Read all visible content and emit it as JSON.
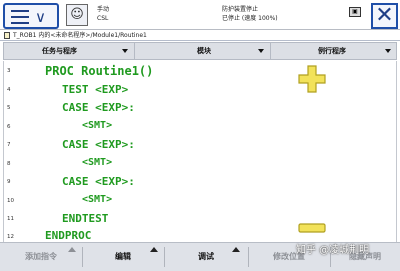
{
  "topbar": {
    "mode_label": "手动",
    "mode_sub": "CSL",
    "safety_label": "防护装置停止",
    "run_state": "已停止 (速度 100%)",
    "colors": {
      "accent": "#1f4fa8"
    }
  },
  "breadcrumb": {
    "text": "T_ROB1 内的<未命名程序>/Module1/Routine1"
  },
  "tabs": [
    {
      "label": "任务与程序"
    },
    {
      "label": "模块"
    },
    {
      "label": "例行程序"
    }
  ],
  "editor": {
    "code_color": "#1f9a1f",
    "lines": [
      {
        "num": "3",
        "text": "PROC Routine1()"
      },
      {
        "num": "4",
        "text": "TEST <EXP>"
      },
      {
        "num": "5",
        "text": "CASE <EXP>:"
      },
      {
        "num": "6",
        "text": "<SMT>"
      },
      {
        "num": "7",
        "text": "CASE <EXP>:"
      },
      {
        "num": "8",
        "text": "<SMT>"
      },
      {
        "num": "9",
        "text": "CASE <EXP>:"
      },
      {
        "num": "10",
        "text": "<SMT>"
      },
      {
        "num": "11",
        "text": "ENDTEST"
      },
      {
        "num": "12",
        "text": "ENDPROC"
      }
    ]
  },
  "zoom": {
    "in_icon": "plus-icon",
    "out_icon": "minus-icon",
    "color": "#f2e25a"
  },
  "bottombar": {
    "add_instruction": "添加指令",
    "edit": "编辑",
    "debug": "调试",
    "modify_position": "修改位置",
    "hide_declarations": "隐藏声明"
  },
  "watermark": "知乎 @凌城荆明"
}
